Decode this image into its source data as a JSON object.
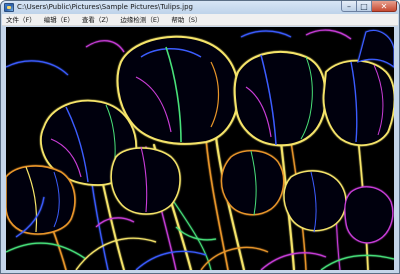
{
  "window": {
    "title": "C:\\Users\\Public\\Pictures\\Sample Pictures\\Tulips.jpg",
    "icon": "picture-icon",
    "buttons": {
      "minimize": "–",
      "maximize": "□",
      "close": "✕"
    }
  },
  "menubar": {
    "items": [
      {
        "label": "文件（F）"
      },
      {
        "label": "编辑（E）"
      },
      {
        "label": "查看（Z）"
      },
      {
        "label": "边缘检测（E）"
      },
      {
        "label": "帮助（S）"
      }
    ]
  },
  "image": {
    "description_icon": "edge-detected-tulips-image",
    "colors": {
      "background": "#000000",
      "edge_yellow": "#f5e46a",
      "edge_blue": "#3a5cff",
      "edge_magenta": "#c83cd8",
      "edge_green": "#47e07a",
      "edge_orange": "#e8952a"
    }
  }
}
